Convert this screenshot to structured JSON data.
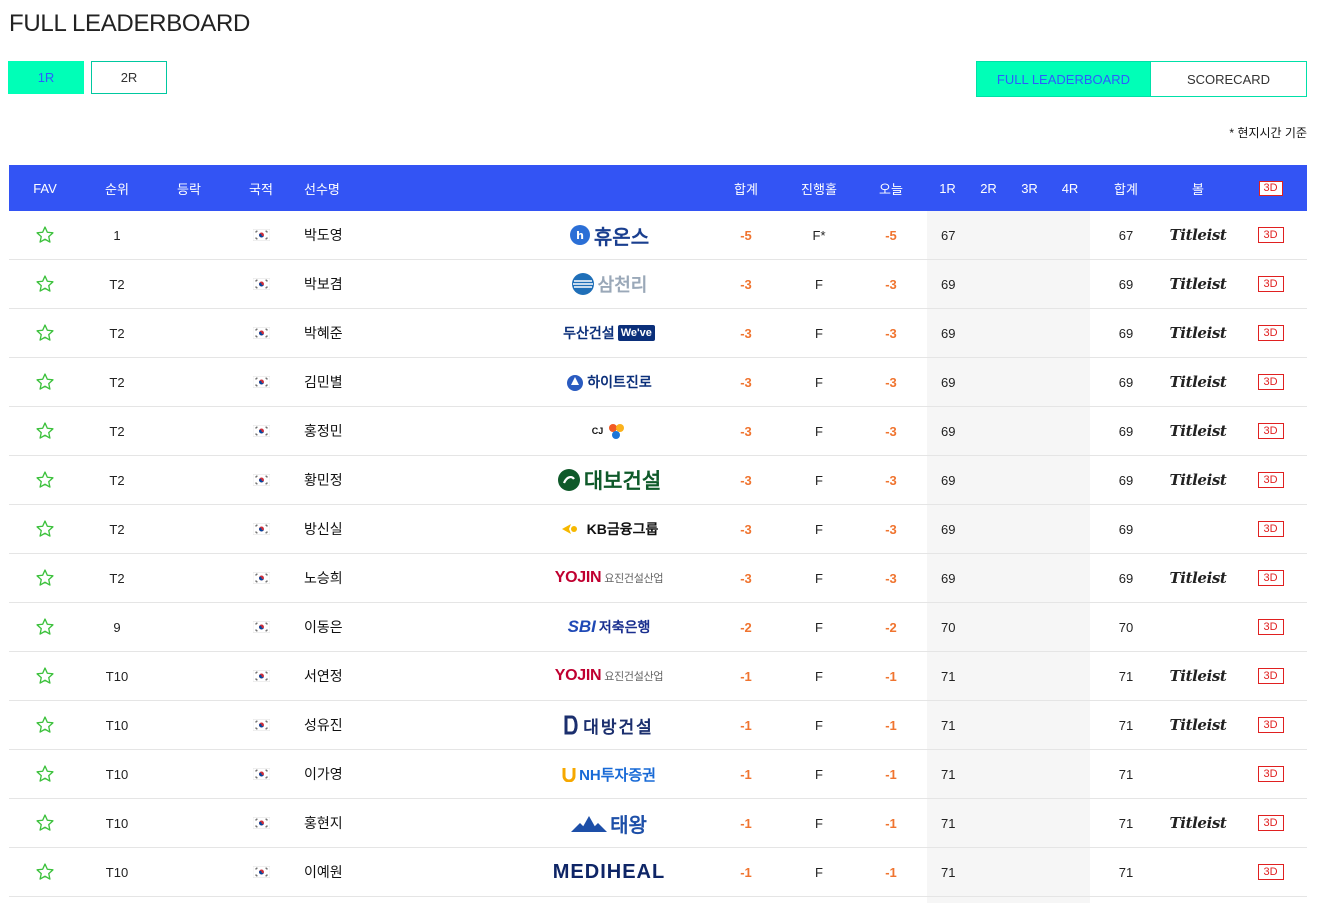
{
  "page": {
    "title": "FULL LEADERBOARD",
    "time_note": "* 현지시간 기준"
  },
  "round_tabs": [
    {
      "label": "1R",
      "active": true
    },
    {
      "label": "2R",
      "active": false
    }
  ],
  "view_tabs": [
    {
      "label": "FULL LEADERBOARD",
      "active": true
    },
    {
      "label": "SCORECARD",
      "active": false
    }
  ],
  "columns": {
    "fav": "FAV",
    "rank": "순위",
    "move": "등락",
    "nation": "국적",
    "name": "선수명",
    "total": "합계",
    "thru": "진행홀",
    "today": "오늘",
    "r1": "1R",
    "r2": "2R",
    "r3": "3R",
    "r4": "4R",
    "sum": "합계",
    "ball": "볼",
    "view3d": "3D"
  },
  "players": [
    {
      "rank": "1",
      "name": "박도영",
      "sponsor": "휴온스",
      "total": "-5",
      "thru": "F*",
      "today": "-5",
      "r1": "67",
      "sum": "67",
      "ball": "Titleist",
      "view3d": "3D"
    },
    {
      "rank": "T2",
      "name": "박보겸",
      "sponsor": "삼천리",
      "total": "-3",
      "thru": "F",
      "today": "-3",
      "r1": "69",
      "sum": "69",
      "ball": "Titleist",
      "view3d": "3D"
    },
    {
      "rank": "T2",
      "name": "박혜준",
      "sponsor": "두산건설",
      "total": "-3",
      "thru": "F",
      "today": "-3",
      "r1": "69",
      "sum": "69",
      "ball": "Titleist",
      "view3d": "3D"
    },
    {
      "rank": "T2",
      "name": "김민별",
      "sponsor": "하이트진로",
      "total": "-3",
      "thru": "F",
      "today": "-3",
      "r1": "69",
      "sum": "69",
      "ball": "Titleist",
      "view3d": "3D"
    },
    {
      "rank": "T2",
      "name": "홍정민",
      "sponsor": "CJ",
      "total": "-3",
      "thru": "F",
      "today": "-3",
      "r1": "69",
      "sum": "69",
      "ball": "Titleist",
      "view3d": "3D"
    },
    {
      "rank": "T2",
      "name": "황민정",
      "sponsor": "대보건설",
      "total": "-3",
      "thru": "F",
      "today": "-3",
      "r1": "69",
      "sum": "69",
      "ball": "Titleist",
      "view3d": "3D"
    },
    {
      "rank": "T2",
      "name": "방신실",
      "sponsor": "KB금융그룹",
      "total": "-3",
      "thru": "F",
      "today": "-3",
      "r1": "69",
      "sum": "69",
      "ball": "",
      "view3d": "3D"
    },
    {
      "rank": "T2",
      "name": "노승희",
      "sponsor": "요진건설산업",
      "total": "-3",
      "thru": "F",
      "today": "-3",
      "r1": "69",
      "sum": "69",
      "ball": "Titleist",
      "view3d": "3D"
    },
    {
      "rank": "9",
      "name": "이동은",
      "sponsor": "SBI저축은행",
      "total": "-2",
      "thru": "F",
      "today": "-2",
      "r1": "70",
      "sum": "70",
      "ball": "",
      "view3d": "3D"
    },
    {
      "rank": "T10",
      "name": "서연정",
      "sponsor": "요진건설산업",
      "total": "-1",
      "thru": "F",
      "today": "-1",
      "r1": "71",
      "sum": "71",
      "ball": "Titleist",
      "view3d": "3D"
    },
    {
      "rank": "T10",
      "name": "성유진",
      "sponsor": "대방건설",
      "total": "-1",
      "thru": "F",
      "today": "-1",
      "r1": "71",
      "sum": "71",
      "ball": "Titleist",
      "view3d": "3D"
    },
    {
      "rank": "T10",
      "name": "이가영",
      "sponsor": "NH투자증권",
      "total": "-1",
      "thru": "F",
      "today": "-1",
      "r1": "71",
      "sum": "71",
      "ball": "",
      "view3d": "3D"
    },
    {
      "rank": "T10",
      "name": "홍현지",
      "sponsor": "태왕",
      "total": "-1",
      "thru": "F",
      "today": "-1",
      "r1": "71",
      "sum": "71",
      "ball": "Titleist",
      "view3d": "3D"
    },
    {
      "rank": "T10",
      "name": "이예원",
      "sponsor": "MEDIHEAL",
      "total": "-1",
      "thru": "F",
      "today": "-1",
      "r1": "71",
      "sum": "71",
      "ball": "",
      "view3d": "3D"
    }
  ],
  "sponsor_logos": {
    "doosan_badge": "We've",
    "yojin_mark": "YOJIN",
    "yojin_sub": "요진건설산업",
    "sbi_mark": "SBI",
    "sbi_sub": "저축은행",
    "kb_text": "KB금융그룹",
    "nh_text": "NH투자증권"
  },
  "colors": {
    "header_bg": "#3354f4",
    "tab_active_bg": "#00ffb7",
    "tab_active_text": "#2d5bff",
    "score_negative": "#f0742f",
    "badge_3d": "#e02020",
    "fav_star": "#3cc13c"
  },
  "icons": {
    "fav": "star-outline-icon",
    "nation": "korea-flag-icon"
  }
}
